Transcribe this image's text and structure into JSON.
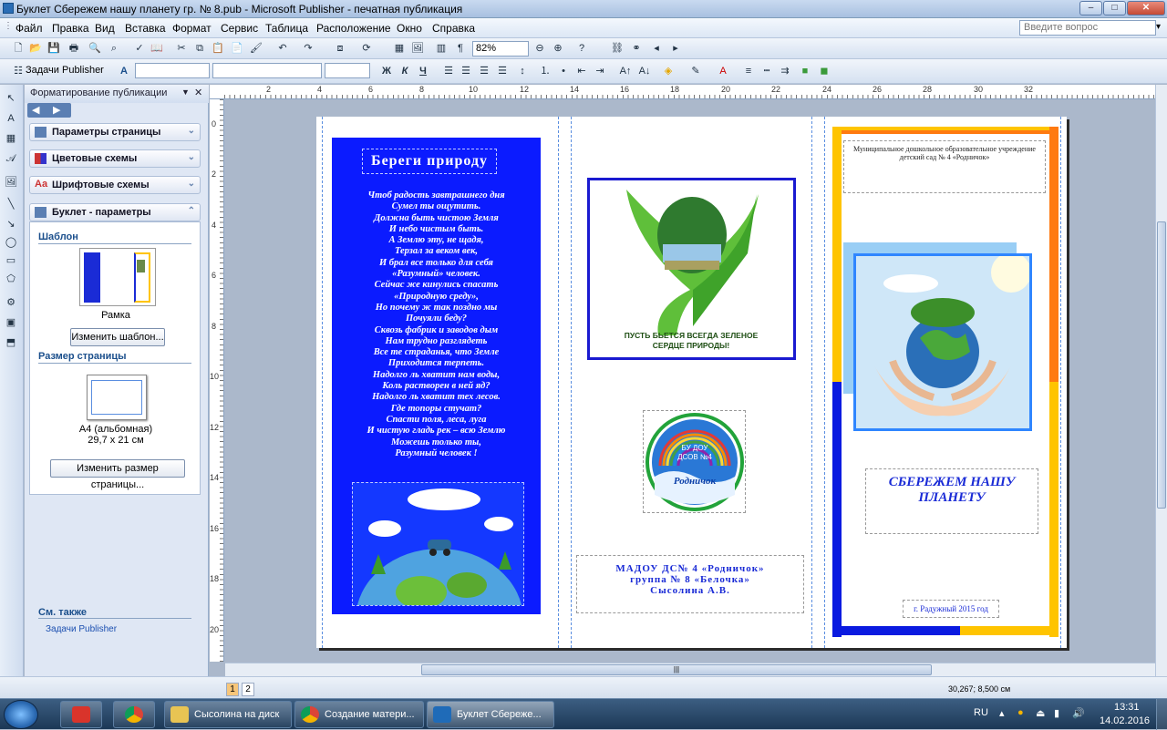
{
  "window": {
    "title": "Буклет Сбережем нашу планету гр. № 8.pub - Microsoft Publisher - печатная публикация",
    "min": "–",
    "max": "□",
    "close": "✕"
  },
  "menu": [
    "Файл",
    "Правка",
    "Вид",
    "Вставка",
    "Формат",
    "Сервис",
    "Таблица",
    "Расположение",
    "Окно",
    "Справка"
  ],
  "help_placeholder": "Введите вопрос",
  "toolbar": {
    "zoom": "82%",
    "tasks_label": "Задачи Publisher",
    "bold": "Ж",
    "italic": "К",
    "underline": "Ч"
  },
  "taskpane": {
    "title": "Форматирование публикации",
    "sections": [
      "Параметры страницы",
      "Цветовые схемы",
      "Шрифтовые схемы",
      "Буклет - параметры"
    ],
    "template_heading": "Шаблон",
    "template_name": "Рамка",
    "change_template": "Изменить шаблон...",
    "size_heading": "Размер страницы",
    "size_name": "A4 (альбомная)",
    "size_dims": "29,7 x 21 см",
    "change_size": "Изменить размер страницы...",
    "see_also": "См. также",
    "see_also_link": "Задачи Publisher"
  },
  "ruler": {
    "h": [
      "2",
      "4",
      "6",
      "8",
      "10",
      "12",
      "14",
      "16",
      "18",
      "20",
      "22",
      "24",
      "26",
      "28",
      "30",
      "32"
    ],
    "v": [
      "0",
      "2",
      "4",
      "6",
      "8",
      "10",
      "12",
      "14",
      "16",
      "18",
      "20"
    ]
  },
  "document": {
    "panel1_title": "Береги природу",
    "poem": [
      "Чтоб радость завтрашнего дня",
      "Сумел ты ощутить.",
      "Должна быть чистою Земля",
      "И небо чистым быть.",
      "А Землю эту, не щадя,",
      "Терзал за веком век,",
      "И брал все только для себя",
      "«Разумный» человек.",
      "Сейчас же кинулись спасать",
      "«Природную среду»,",
      "Но почему ж так поздно мы",
      "Почуяли беду?",
      "Сквозь фабрик и заводов дым",
      "Нам трудно разглядеть",
      "Все те страданья, что Земле",
      "Приходится терпеть.",
      "Надолго ль хватит нам воды,",
      "Коль растворен в ней яд?",
      "Надолго ль хватит тех лесов.",
      "Где топоры стучат?",
      "Спасти поля, леса, луга",
      "И чистую гладь рек – всю Землю",
      "Можешь только ты,",
      "Разумный человек !"
    ],
    "hands_caption": [
      "ПУСТЬ БЬЕТСЯ ВСЕГДА ЗЕЛЕНОЕ",
      "СЕРДЦЕ ПРИРОДЫ!"
    ],
    "logo_text": [
      "БУ ДОУ",
      "ДСОВ №4"
    ],
    "logo_name": "Родничок",
    "org_lines": [
      "МАДОУ ДС№ 4 «Родничок»",
      "группа № 8 «Белочка»",
      "Сысолина А.В."
    ],
    "org_header": "Муниципальное дошкольное образовательное учреждение детский сад № 4 «Родничок»",
    "main_title": "СБЕРЕЖЕМ НАШУ ПЛАНЕТУ",
    "city": "г. Радужный 2015 год"
  },
  "status": {
    "pages": [
      "1",
      "2"
    ],
    "coords": "30,267; 8,500 см"
  },
  "taskbar": {
    "items": [
      "Сысолина на диск",
      "Создание матери...",
      "Буклет Сбереже..."
    ],
    "lang": "RU",
    "time": "13:31",
    "date": "14.02.2016"
  },
  "colors": {
    "panel_blue": "#0b1bff",
    "doc_text_blue": "#1a2bd6",
    "frame_orange": "#ff7a10",
    "frame_yellow": "#ffc400",
    "frame_blue": "#0a1ae0"
  }
}
